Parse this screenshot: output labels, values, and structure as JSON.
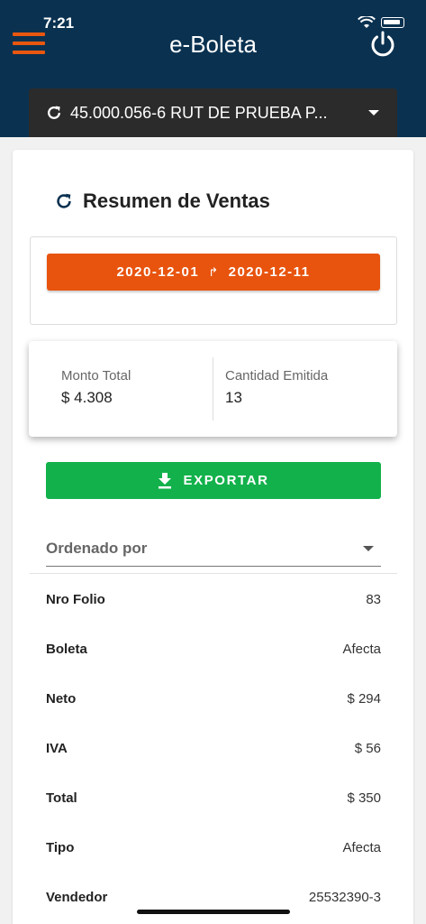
{
  "status_bar": {
    "time": "7:21"
  },
  "header": {
    "title": "e-Boleta"
  },
  "company_select": {
    "label": "45.000.056-6 RUT DE PRUEBA P..."
  },
  "summary": {
    "title": "Resumen de Ventas",
    "date_from": "2020-12-01",
    "date_to": "2020-12-11",
    "range_separator": "↱"
  },
  "stats": {
    "monto_label": "Monto Total",
    "monto_value": "$ 4.308",
    "cantidad_label": "Cantidad Emitida",
    "cantidad_value": "13"
  },
  "export": {
    "label": "EXPORTAR"
  },
  "order": {
    "label": "Ordenado por"
  },
  "detail": [
    {
      "key": "Nro Folio",
      "value": "83"
    },
    {
      "key": "Boleta",
      "value": "Afecta"
    },
    {
      "key": "Neto",
      "value": "$ 294"
    },
    {
      "key": "IVA",
      "value": "$ 56"
    },
    {
      "key": "Total",
      "value": "$ 350"
    },
    {
      "key": "Tipo",
      "value": "Afecta"
    },
    {
      "key": "Vendedor",
      "value": "25532390-3"
    }
  ],
  "colors": {
    "header": "#0a3150",
    "accent_orange": "#e8540e",
    "export_green": "#12b14b",
    "select_dark": "#2b2b2b"
  }
}
